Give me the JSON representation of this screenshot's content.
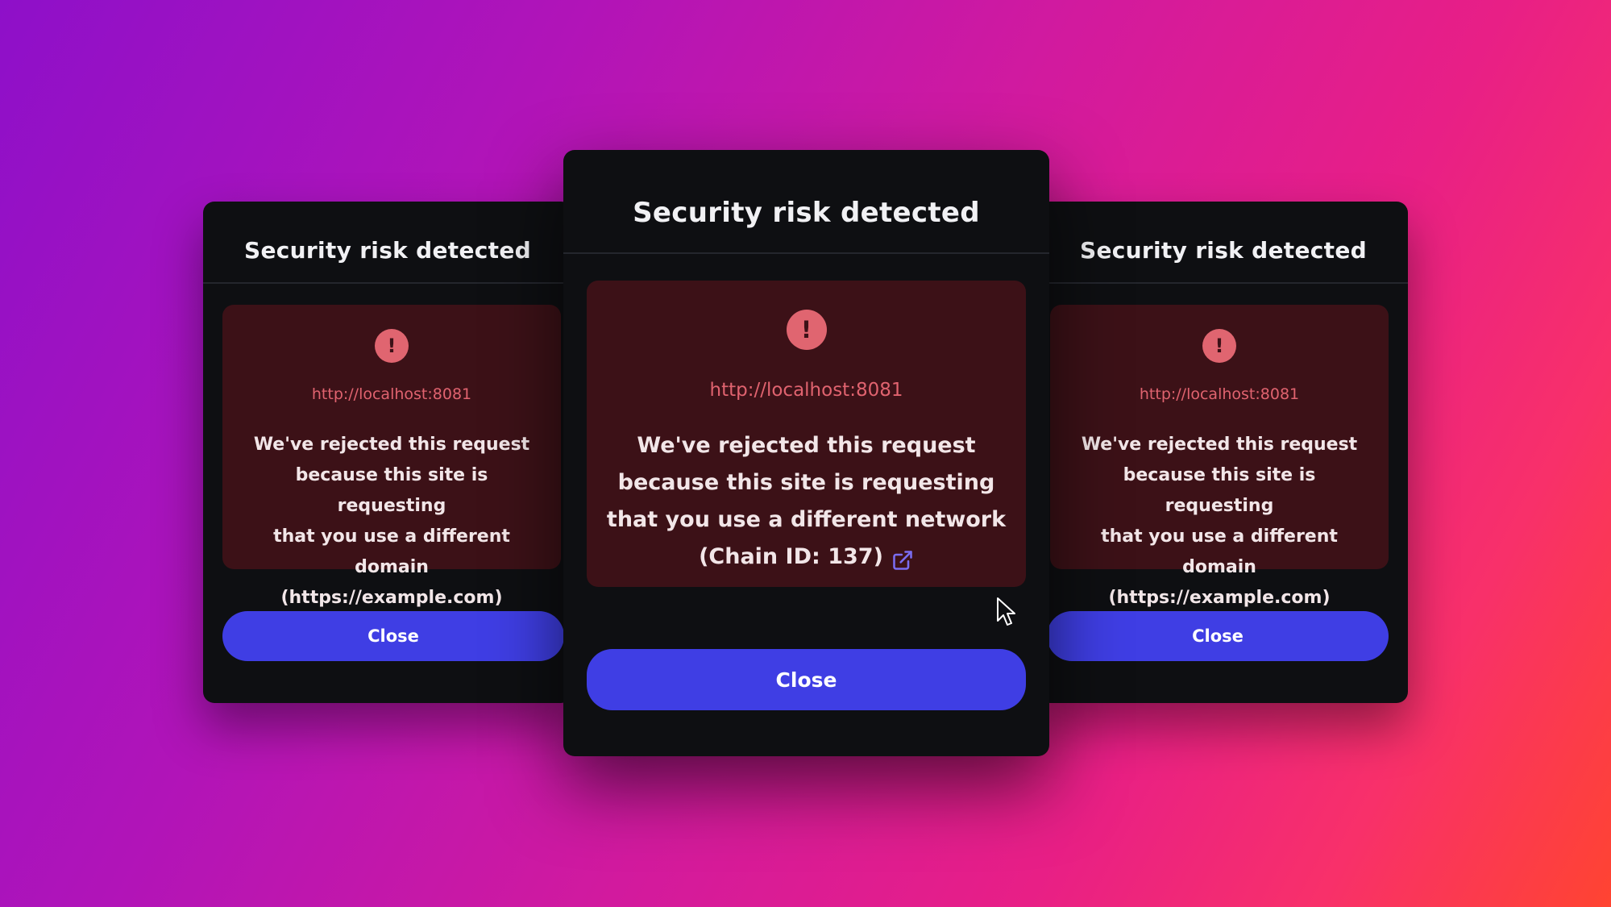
{
  "colors": {
    "card_background": "#0e0f12",
    "warning_background": "#3c1117",
    "warning_accent": "#e06570",
    "button_primary": "#3f3ee4",
    "link_icon": "#7a6cf0"
  },
  "dialogs": {
    "left": {
      "title": "Security risk detected",
      "icon": "exclamation-icon",
      "url": "http://localhost:8081",
      "message_lines": [
        "We've rejected this request",
        "because this site is requesting",
        "that you use a different domain",
        "(https://example.com)"
      ],
      "close_label": "Close"
    },
    "center": {
      "title": "Security risk detected",
      "icon": "exclamation-icon",
      "url": "http://localhost:8081",
      "message_lines": [
        "We've rejected this request",
        "because this site is requesting",
        "that you use a different network",
        "(Chain ID: 137)"
      ],
      "link_icon": "external-link-icon",
      "close_label": "Close"
    },
    "right": {
      "title": "Security risk detected",
      "icon": "exclamation-icon",
      "url": "http://localhost:8081",
      "message_lines": [
        "We've rejected this request",
        "because this site is requesting",
        "that you use a different domain",
        "(https://example.com)"
      ],
      "close_label": "Close"
    }
  },
  "cursor": {
    "icon": "mouse-pointer-icon"
  }
}
